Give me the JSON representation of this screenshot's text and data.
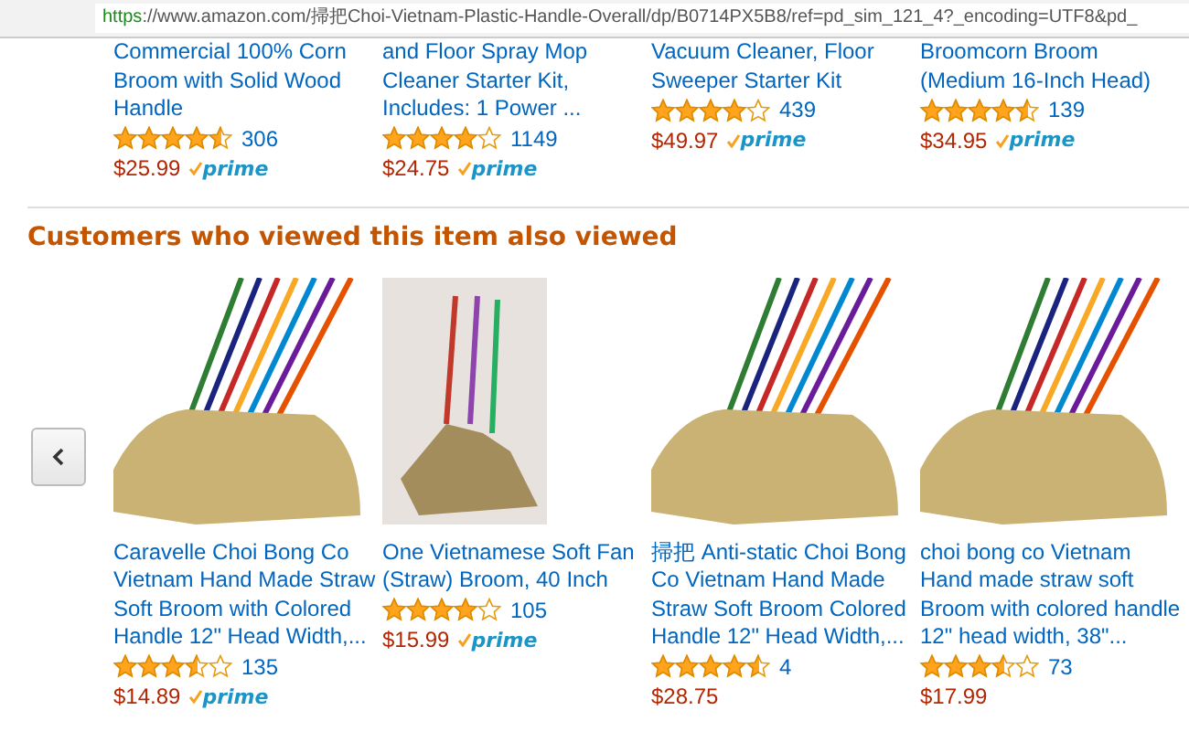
{
  "address_bar": {
    "url_scheme": "https",
    "url_rest": "://www.amazon.com/掃把Choi-Vietnam-Plastic-Handle-Overall/dp/B0714PX5B8/ref=pd_sim_121_4?_encoding=UTF8&pd_"
  },
  "top_products": [
    {
      "title_lines": [
        "Commercial 100% Corn",
        "Broom with Solid Wood",
        "Handle"
      ],
      "stars": 4.5,
      "reviews": "306",
      "price": "$25.99",
      "prime": "prime"
    },
    {
      "title_lines": [
        "and Floor Spray Mop",
        "Cleaner Starter Kit,",
        "Includes: 1 Power ..."
      ],
      "stars": 4,
      "reviews": "1149",
      "price": "$24.75",
      "prime": "prime"
    },
    {
      "title_lines": [
        "Vacuum Cleaner, Floor",
        "Sweeper Starter Kit"
      ],
      "stars": 4,
      "reviews": "439",
      "price": "$49.97",
      "prime": "prime"
    },
    {
      "title_lines": [
        "Broomcorn Broom",
        "(Medium 16-Inch Head)"
      ],
      "stars": 4.5,
      "reviews": "139",
      "price": "$34.95",
      "prime": "prime"
    }
  ],
  "section_title": "Customers who viewed this item also viewed",
  "products": [
    {
      "title_lines": [
        "Caravelle Choi Bong Co",
        "Vietnam Hand Made Straw",
        "Soft Broom with Colored",
        "Handle 12\" Head Width,..."
      ],
      "stars": 3.5,
      "reviews": "135",
      "price": "$14.89",
      "prime": "prime"
    },
    {
      "title_lines": [
        "One Vietnamese Soft Fan",
        "(Straw) Broom, 40 Inch"
      ],
      "stars": 4,
      "reviews": "105",
      "price": "$15.99",
      "prime": "prime"
    },
    {
      "title_lines": [
        "掃把 Anti-static Choi Bong",
        "Co Vietnam Hand Made",
        "Straw Soft Broom Colored",
        "Handle 12\" Head Width,..."
      ],
      "stars": 4.5,
      "reviews": "4",
      "price": "$28.75"
    },
    {
      "title_lines": [
        "choi bong co Vietnam",
        "Hand made straw soft",
        "Broom with colored handle",
        "12\" head width, 38\"..."
      ],
      "stars": 3.5,
      "reviews": "73",
      "price": "$17.99"
    }
  ]
}
